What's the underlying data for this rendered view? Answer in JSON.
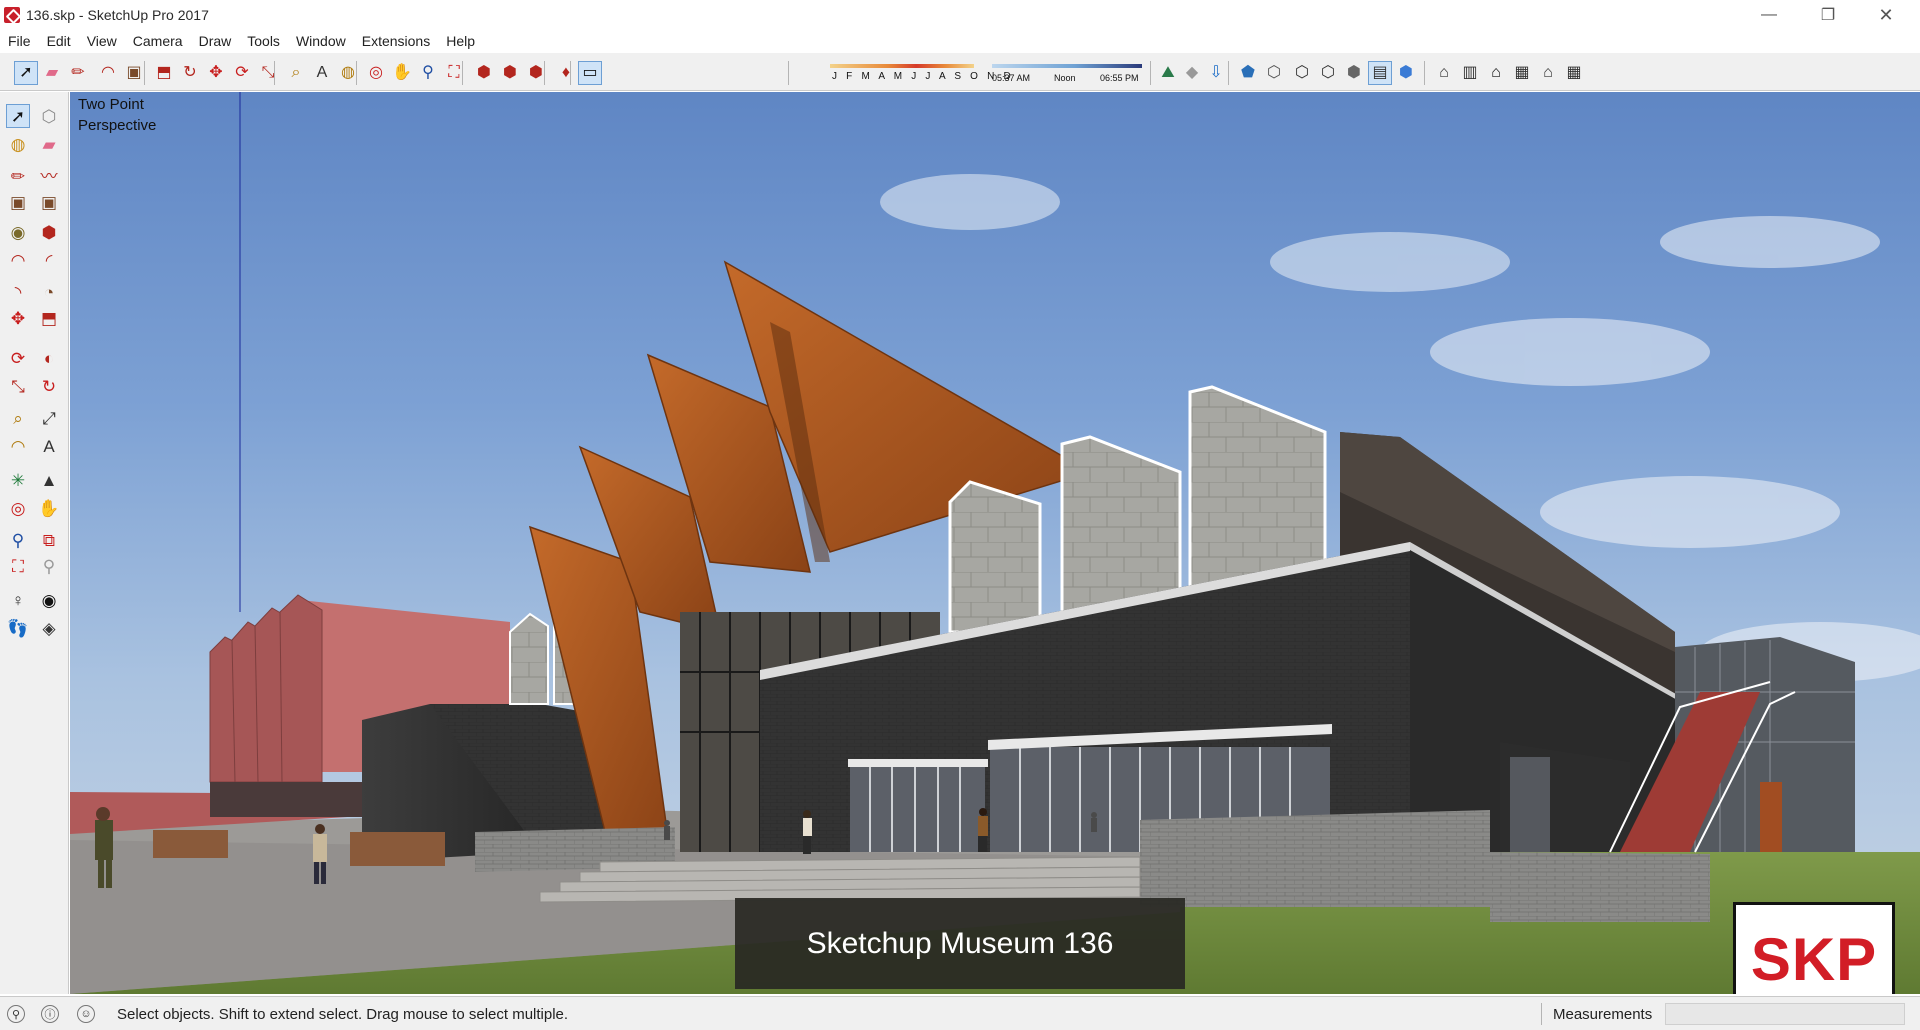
{
  "window": {
    "title": "136.skp - SketchUp Pro 2017",
    "minimize_glyph": "—",
    "maximize_glyph": "❐",
    "close_glyph": "✕"
  },
  "menu": [
    "File",
    "Edit",
    "View",
    "Camera",
    "Draw",
    "Tools",
    "Window",
    "Extensions",
    "Help"
  ],
  "toolbar": {
    "shadow_months": "J F M A M J J A S O N D",
    "shadow_time_start": "05:37 AM",
    "shadow_time_mid": "Noon",
    "shadow_time_end": "06:55 PM",
    "buttons": [
      {
        "name": "select-tool-icon",
        "glyph": "➚",
        "color": "#111111",
        "active": true
      },
      {
        "name": "eraser-tool-icon",
        "glyph": "▰",
        "color": "#e06a8a"
      },
      {
        "name": "line-tool-icon",
        "glyph": "✏",
        "color": "#b3261e"
      },
      {
        "name": "arc-tool-icon",
        "glyph": "◠",
        "color": "#b3261e"
      },
      {
        "name": "rectangle-tool-icon",
        "glyph": "▣",
        "color": "#7a4a2a"
      },
      {
        "name": "push-pull-tool-icon",
        "glyph": "⬒",
        "color": "#b3261e"
      },
      {
        "name": "offset-tool-icon",
        "glyph": "↻",
        "color": "#b3261e"
      },
      {
        "name": "move-tool-icon",
        "glyph": "✥",
        "color": "#c81e1e"
      },
      {
        "name": "rotate-tool-icon",
        "glyph": "⟳",
        "color": "#c81e1e"
      },
      {
        "name": "scale-tool-icon",
        "glyph": "⤡",
        "color": "#b3261e"
      },
      {
        "name": "tape-measure-tool-icon",
        "glyph": "⌕",
        "color": "#b07c10"
      },
      {
        "name": "text-tool-icon",
        "glyph": "A",
        "color": "#333333"
      },
      {
        "name": "paint-bucket-tool-icon",
        "glyph": "◍",
        "color": "#b07c10"
      },
      {
        "name": "orbit-tool-icon",
        "glyph": "◎",
        "color": "#c81e1e"
      },
      {
        "name": "pan-tool-icon",
        "glyph": "✋",
        "color": "#c8901e"
      },
      {
        "name": "zoom-tool-icon",
        "glyph": "⚲",
        "color": "#1f4ea3"
      },
      {
        "name": "zoom-extents-tool-icon",
        "glyph": "⛶",
        "color": "#c81e1e"
      },
      {
        "name": "3d-warehouse-icon",
        "glyph": "⬢",
        "color": "#b3261e"
      },
      {
        "name": "share-model-icon",
        "glyph": "⬢",
        "color": "#b3261e"
      },
      {
        "name": "extension-warehouse-icon",
        "glyph": "⬢",
        "color": "#b3261e"
      },
      {
        "name": "ruby-console-icon",
        "glyph": "♦",
        "color": "#b3261e"
      },
      {
        "name": "shadows-toggle-icon",
        "glyph": "▭",
        "color": "#111111",
        "active": true
      },
      {
        "name": "add-location-icon",
        "glyph": "⛰",
        "color": "#2a7a4a"
      },
      {
        "name": "toggle-terrain-icon",
        "glyph": "◆",
        "color": "#999999"
      },
      {
        "name": "get-photo-texture-icon",
        "glyph": "⇩",
        "color": "#1f6fc8"
      },
      {
        "name": "xray-style-icon",
        "glyph": "⬟",
        "color": "#2a6fb8"
      },
      {
        "name": "back-edges-style-icon",
        "glyph": "⬡",
        "color": "#555555"
      },
      {
        "name": "wireframe-style-icon",
        "glyph": "⬡",
        "color": "#333333"
      },
      {
        "name": "hidden-line-style-icon",
        "glyph": "⬡",
        "color": "#333333"
      },
      {
        "name": "shaded-style-icon",
        "glyph": "⬢",
        "color": "#666666"
      },
      {
        "name": "shaded-textures-style-icon",
        "glyph": "▤",
        "color": "#333333",
        "active": true
      },
      {
        "name": "monochrome-style-icon",
        "glyph": "⬢",
        "color": "#3a7bd5"
      },
      {
        "name": "iso-view-icon",
        "glyph": "⌂",
        "color": "#333333"
      },
      {
        "name": "top-view-icon",
        "glyph": "▥",
        "color": "#333333"
      },
      {
        "name": "front-view-icon",
        "glyph": "⌂",
        "color": "#111111"
      },
      {
        "name": "right-view-icon",
        "glyph": "▦",
        "color": "#333333"
      },
      {
        "name": "back-view-icon",
        "glyph": "⌂",
        "color": "#333333"
      },
      {
        "name": "left-view-icon",
        "glyph": "▦",
        "color": "#333333"
      }
    ]
  },
  "palette": [
    {
      "name": "select-tool-icon",
      "glyph": "➚",
      "color": "#111111",
      "active": true
    },
    {
      "name": "make-component-icon",
      "glyph": "⬡",
      "color": "#888888"
    },
    {
      "name": "paint-bucket-icon",
      "glyph": "◍",
      "color": "#c8901e"
    },
    {
      "name": "eraser-icon",
      "glyph": "▰",
      "color": "#e06a8a"
    },
    {
      "name": "line-icon",
      "glyph": "✏",
      "color": "#b3261e"
    },
    {
      "name": "freehand-icon",
      "glyph": "〰",
      "color": "#b3261e"
    },
    {
      "name": "rectangle-icon",
      "glyph": "▣",
      "color": "#7a4a2a"
    },
    {
      "name": "rotated-rectangle-icon",
      "glyph": "▣",
      "color": "#7a4a2a"
    },
    {
      "name": "circle-icon",
      "glyph": "◉",
      "color": "#7a6a2a"
    },
    {
      "name": "polygon-icon",
      "glyph": "⬢",
      "color": "#b3261e"
    },
    {
      "name": "arc-icon",
      "glyph": "◠",
      "color": "#b3261e"
    },
    {
      "name": "two-point-arc-icon",
      "glyph": "◜",
      "color": "#b3261e"
    },
    {
      "name": "three-point-arc-icon",
      "glyph": "◝",
      "color": "#b3261e"
    },
    {
      "name": "pie-icon",
      "glyph": "◔",
      "color": "#7a4a2a"
    },
    {
      "name": "move-icon",
      "glyph": "✥",
      "color": "#c81e1e"
    },
    {
      "name": "push-pull-icon",
      "glyph": "⬒",
      "color": "#b3261e"
    },
    {
      "name": "rotate-icon",
      "glyph": "⟳",
      "color": "#c81e1e"
    },
    {
      "name": "follow-me-icon",
      "glyph": "◐",
      "color": "#b3261e"
    },
    {
      "name": "scale-icon",
      "glyph": "⤡",
      "color": "#b3261e"
    },
    {
      "name": "offset-icon",
      "glyph": "↻",
      "color": "#c81e1e"
    },
    {
      "name": "tape-measure-icon",
      "glyph": "⌕",
      "color": "#b07c10"
    },
    {
      "name": "dimension-icon",
      "glyph": "⤢",
      "color": "#333333"
    },
    {
      "name": "protractor-icon",
      "glyph": "◠",
      "color": "#b07c10"
    },
    {
      "name": "text-icon",
      "glyph": "A",
      "color": "#333333"
    },
    {
      "name": "axes-icon",
      "glyph": "✳",
      "color": "#1f7a3a"
    },
    {
      "name": "3d-text-icon",
      "glyph": "▲",
      "color": "#333333"
    },
    {
      "name": "orbit-icon",
      "glyph": "◎",
      "color": "#c81e1e"
    },
    {
      "name": "pan-icon",
      "glyph": "✋",
      "color": "#c8901e"
    },
    {
      "name": "zoom-icon",
      "glyph": "⚲",
      "color": "#1f4ea3"
    },
    {
      "name": "zoom-window-icon",
      "glyph": "⧉",
      "color": "#c81e1e"
    },
    {
      "name": "zoom-extents-icon",
      "glyph": "⛶",
      "color": "#c81e1e"
    },
    {
      "name": "previous-view-icon",
      "glyph": "⚲",
      "color": "#999999"
    },
    {
      "name": "position-camera-icon",
      "glyph": "♀",
      "color": "#333333"
    },
    {
      "name": "look-around-icon",
      "glyph": "◉",
      "color": "#111111"
    },
    {
      "name": "walk-icon",
      "glyph": "👣",
      "color": "#111111"
    },
    {
      "name": "section-plane-icon",
      "glyph": "◈",
      "color": "#333333"
    }
  ],
  "viewport": {
    "camera_label": "Two Point Perspective",
    "caption": "Sketchup Museum 136",
    "badge": "SKP"
  },
  "status": {
    "geo_icon": "geo-location-icon",
    "credits_icon": "credits-icon",
    "user_icon": "user-icon",
    "message": "Select objects. Shift to extend select. Drag mouse to select multiple.",
    "measurements_label": "Measurements",
    "measurements_value": ""
  }
}
